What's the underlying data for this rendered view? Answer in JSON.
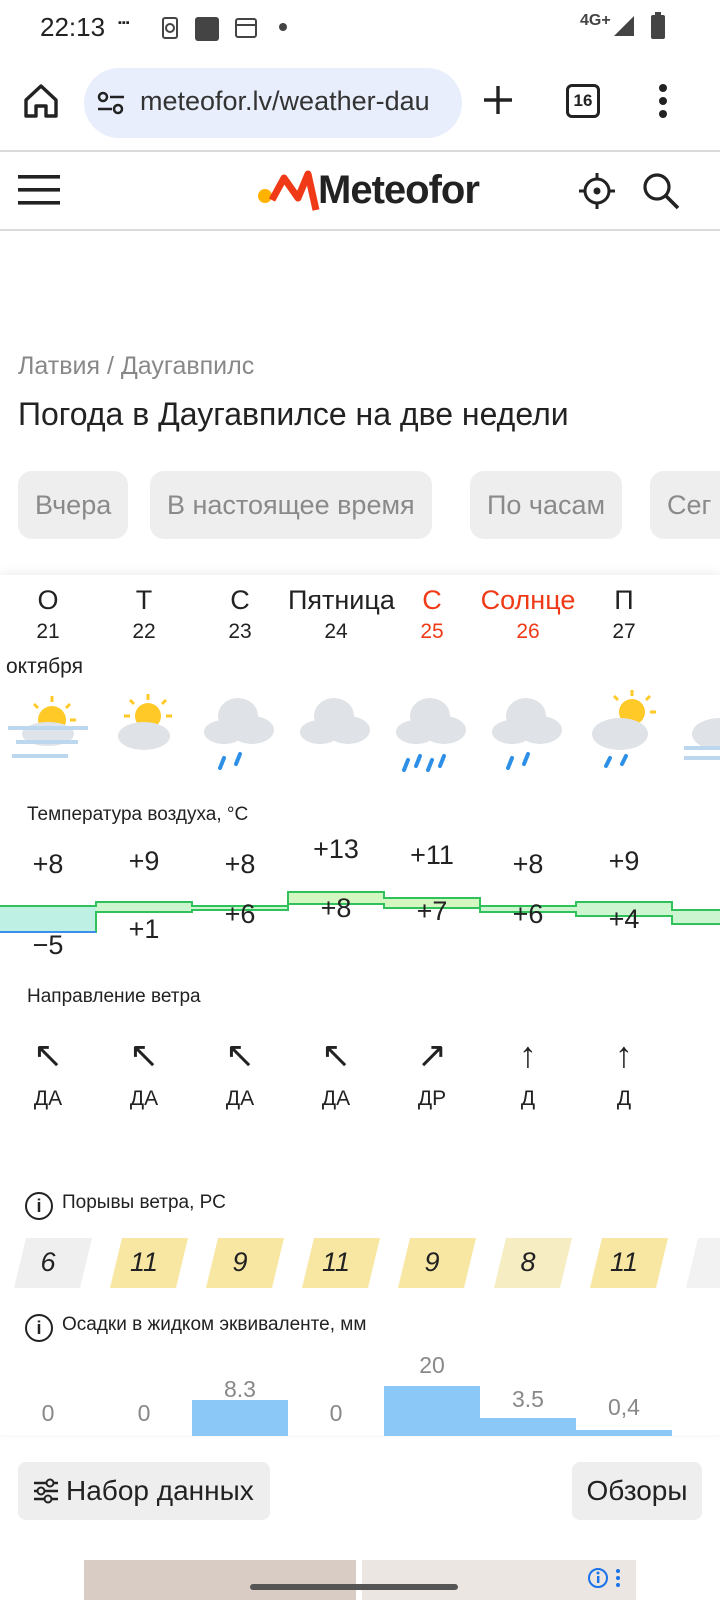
{
  "status_bar": {
    "time": "22:13",
    "network": "4G+"
  },
  "browser": {
    "url": "meteofor.lv/weather-dau",
    "tab_count": "16"
  },
  "site": {
    "logo_text": "Meteofor"
  },
  "breadcrumb": "Латвия / Даугавпилс",
  "page_title": "Погода в Даугавпилсе на две недели",
  "tabs": [
    "Вчера",
    "В настоящее время",
    "По часам",
    "Сег"
  ],
  "days": [
    {
      "name": "О",
      "date": "21",
      "weekend": false,
      "icon": "sun-cloud-fog-icon"
    },
    {
      "name": "Т",
      "date": "22",
      "weekend": false,
      "icon": "sun-cloud-icon"
    },
    {
      "name": "С",
      "date": "23",
      "weekend": false,
      "icon": "cloud-rain-icon"
    },
    {
      "name": "Пятница",
      "date": "24",
      "weekend": false,
      "icon": "cloud-icon"
    },
    {
      "name": "С",
      "date": "25",
      "weekend": true,
      "icon": "cloud-heavy-rain-icon"
    },
    {
      "name": "Солнце",
      "date": "26",
      "weekend": true,
      "icon": "cloud-rain-icon"
    },
    {
      "name": "П",
      "date": "27",
      "weekend": false,
      "icon": "sun-cloud-rain-icon"
    }
  ],
  "month_label": "октября",
  "temperature": {
    "label": "Температура воздуха, °C",
    "max": [
      "+8",
      "+9",
      "+8",
      "+13",
      "+11",
      "+8",
      "+9"
    ],
    "min": [
      "−5",
      "+1",
      "+6",
      "+8",
      "+7",
      "+6",
      "+4"
    ]
  },
  "wind": {
    "label": "Направление ветра",
    "directions": [
      "ДА",
      "ДА",
      "ДА",
      "ДА",
      "ДР",
      "Д",
      "Д"
    ],
    "arrows": [
      "↖",
      "↖",
      "↖",
      "↖",
      "↗",
      "↑",
      "↑"
    ]
  },
  "gusts": {
    "label": "Порывы ветра, РС",
    "values": [
      "6",
      "11",
      "9",
      "11",
      "9",
      "8",
      "11"
    ]
  },
  "precipitation": {
    "label": "Осадки в жидком эквиваленте, мм",
    "values": [
      "0",
      "0",
      "8.3",
      "0",
      "20",
      "3.5",
      "0,4"
    ]
  },
  "buttons": {
    "dataset": "Набор данных",
    "reviews": "Обзоры"
  },
  "colors": {
    "weekend": "#f03a17",
    "temp_band": "#c7f5c7",
    "precip_bar": "#8cc8f7",
    "gust_bg": "#f7e7a3"
  }
}
